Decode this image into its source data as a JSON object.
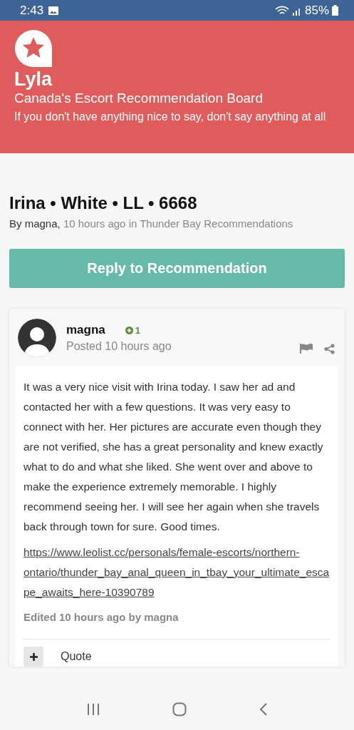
{
  "status_bar": {
    "time": "2:43",
    "battery": "85%"
  },
  "header": {
    "site_name": "Lyla",
    "tagline": "Canada's Escort Recommendation Board",
    "motto": "If you don't have anything nice to say, don't say anything at all"
  },
  "topic": {
    "title": "Irina • White • LL • 6668",
    "byline_author": "By magna,",
    "byline_rest": "10 hours ago in Thunder Bay Recommendations"
  },
  "reply_button": "Reply to Recommendation",
  "post": {
    "author": "magna",
    "reputation": "1",
    "posted": "Posted 10 hours ago",
    "body": "It was a very nice visit with Irina today. I saw her ad and contacted her with a few questions. It was very easy to connect with her. Her pictures are accurate even though they are not verified, she has a great personality and knew exactly what to do and what she liked. She went over and above to make the experience extremely memorable. I highly recommend seeing her. I will see her again when she travels back through town for sure. Good times.",
    "link": "https://www.leolist.cc/personals/female-escorts/northern-ontario/thunder_bay_anal_queen_in_tbay_your_ultimate_escape_awaits_here-10390789",
    "edited": "Edited 10 hours ago by magna",
    "quote_button": "Quote"
  }
}
